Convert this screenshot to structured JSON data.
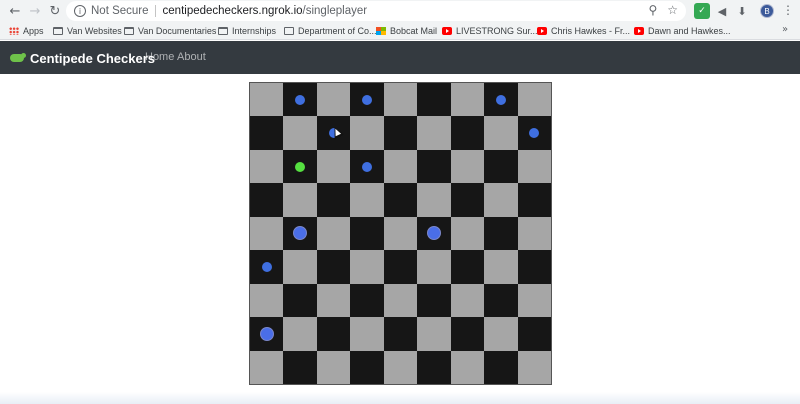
{
  "browser": {
    "security_label": "Not Secure",
    "url_host": "centipedecheckers.ngrok.io",
    "url_path": "/singleplayer",
    "profile_initial": "B",
    "bookmarks": [
      {
        "label": "Apps",
        "icon": "apps-icon"
      },
      {
        "label": "Van Websites",
        "icon": "folder-icon"
      },
      {
        "label": "Van Documentaries",
        "icon": "folder-icon"
      },
      {
        "label": "Internships",
        "icon": "folder-icon"
      },
      {
        "label": "Department of Co...",
        "icon": "document-icon"
      },
      {
        "label": "Bobcat Mail",
        "icon": "mail-grid-icon"
      },
      {
        "label": "LIVESTRONG Sur...",
        "icon": "youtube-icon"
      },
      {
        "label": "Chris Hawkes - Fr...",
        "icon": "youtube-icon"
      },
      {
        "label": "Dawn and Hawkes...",
        "icon": "youtube-icon"
      }
    ]
  },
  "navbar": {
    "brand": "Centipede Checkers",
    "links": [
      "Home",
      "About"
    ]
  },
  "board": {
    "size": 9,
    "light_color": "#a6a6a6",
    "dark_color": "#161616",
    "pieces": [
      {
        "row": 0,
        "col": 1,
        "color": "#3f6fe0",
        "size": "small"
      },
      {
        "row": 0,
        "col": 3,
        "color": "#3f6fe0",
        "size": "small"
      },
      {
        "row": 0,
        "col": 7,
        "color": "#3f6fe0",
        "size": "small"
      },
      {
        "row": 1,
        "col": 2,
        "color": "#3f6fe0",
        "size": "small"
      },
      {
        "row": 1,
        "col": 8,
        "color": "#3f6fe0",
        "size": "small"
      },
      {
        "row": 2,
        "col": 1,
        "color": "#55e040",
        "size": "small"
      },
      {
        "row": 2,
        "col": 3,
        "color": "#3f6fe0",
        "size": "small"
      },
      {
        "row": 4,
        "col": 1,
        "color": "#4a6ee8",
        "size": "large"
      },
      {
        "row": 4,
        "col": 5,
        "color": "#4a6ee8",
        "size": "large"
      },
      {
        "row": 5,
        "col": 0,
        "color": "#3f6fe0",
        "size": "small"
      },
      {
        "row": 7,
        "col": 0,
        "color": "#4a6ee8",
        "size": "large"
      }
    ]
  }
}
